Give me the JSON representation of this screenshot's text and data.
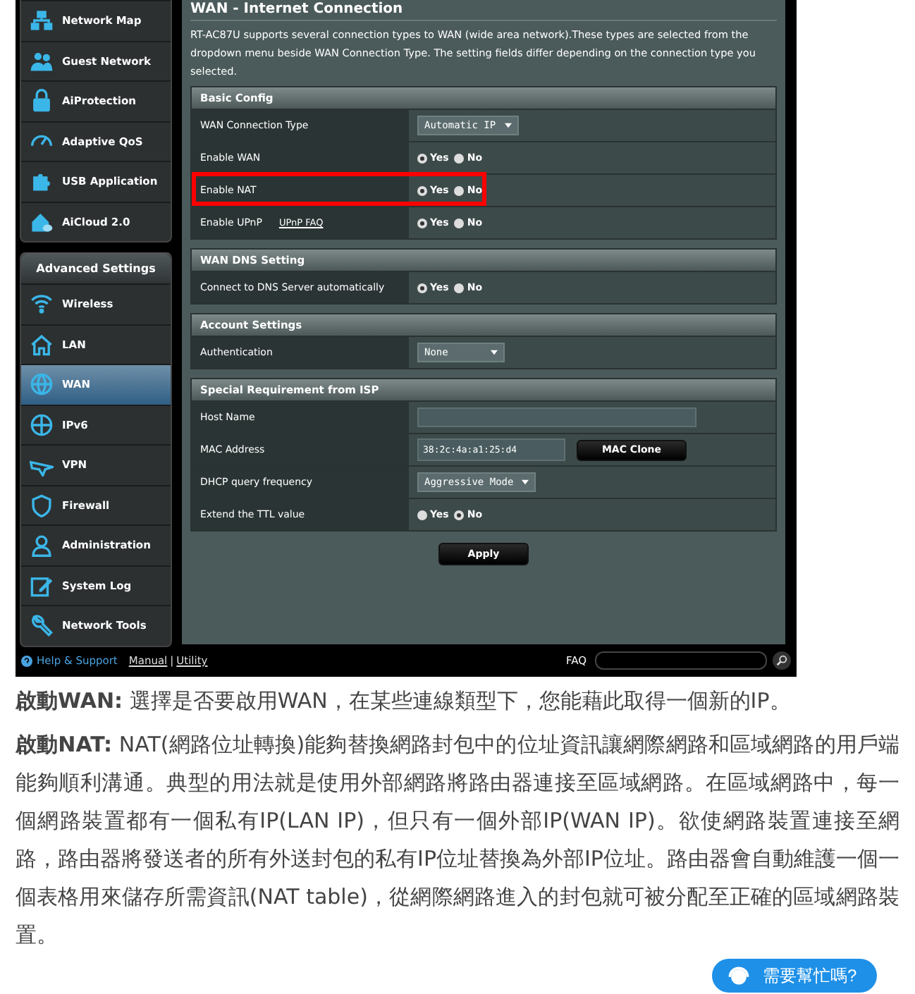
{
  "sidebar": {
    "items": [
      {
        "label": "Network Map",
        "selected": false
      },
      {
        "label": "Guest Network",
        "selected": false
      },
      {
        "label": "AiProtection",
        "selected": false
      },
      {
        "label": "Adaptive QoS",
        "selected": false
      },
      {
        "label": "USB Application",
        "selected": false
      },
      {
        "label": "AiCloud 2.0",
        "selected": false
      }
    ],
    "section_title": "Advanced Settings",
    "advanced_items": [
      {
        "label": "Wireless",
        "selected": false
      },
      {
        "label": "LAN",
        "selected": false
      },
      {
        "label": "WAN",
        "selected": true
      },
      {
        "label": "IPv6",
        "selected": false
      },
      {
        "label": "VPN",
        "selected": false
      },
      {
        "label": "Firewall",
        "selected": false
      },
      {
        "label": "Administration",
        "selected": false
      },
      {
        "label": "System Log",
        "selected": false
      },
      {
        "label": "Network Tools",
        "selected": false
      }
    ]
  },
  "page_title": "WAN - Internet Connection",
  "description": "RT-AC87U supports several connection types to WAN (wide area network).These types are selected from the dropdown menu beside WAN Connection Type. The setting fields differ depending on the connection type you selected.",
  "sections": [
    {
      "title": "Basic Config",
      "rows": [
        {
          "label": "WAN Connection Type",
          "kind": "select",
          "value": "Automatic IP",
          "highlighted": false
        },
        {
          "label": "Enable WAN",
          "kind": "radio",
          "options": [
            {
              "label": "Yes",
              "selected": true
            },
            {
              "label": "No",
              "selected": false
            }
          ],
          "highlighted": false
        },
        {
          "label": "Enable NAT",
          "kind": "radio",
          "options": [
            {
              "label": "Yes",
              "selected": true
            },
            {
              "label": "No",
              "selected": false
            }
          ],
          "highlighted": true
        },
        {
          "label": "Enable UPnP",
          "link": "UPnP  FAQ",
          "kind": "radio",
          "options": [
            {
              "label": "Yes",
              "selected": true
            },
            {
              "label": "No",
              "selected": false
            }
          ],
          "highlighted": false
        }
      ]
    },
    {
      "title": "WAN DNS Setting",
      "rows": [
        {
          "label": "Connect to DNS Server automatically",
          "kind": "radio",
          "options": [
            {
              "label": "Yes",
              "selected": true
            },
            {
              "label": "No",
              "selected": false
            }
          ],
          "highlighted": false
        }
      ]
    },
    {
      "title": "Account Settings",
      "rows": [
        {
          "label": "Authentication",
          "kind": "select",
          "value": "None",
          "highlighted": false
        }
      ]
    },
    {
      "title": "Special Requirement from ISP",
      "rows": [
        {
          "label": "Host Name",
          "kind": "text",
          "highlighted": false
        },
        {
          "label": "MAC Address",
          "kind": "mac",
          "value": "38:2c:4a:a1:25:d4",
          "button": "MAC Clone",
          "highlighted": false
        },
        {
          "label": "DHCP query frequency",
          "kind": "select",
          "value": "Aggressive Mode",
          "highlighted": false
        },
        {
          "label": "Extend the TTL value",
          "kind": "radio",
          "options": [
            {
              "label": "Yes",
              "selected": false
            },
            {
              "label": "No",
              "selected": true
            }
          ],
          "highlighted": false
        }
      ]
    }
  ],
  "apply_button": "Apply",
  "footer": {
    "help": "Help & Support",
    "manual": "Manual",
    "separator": "|",
    "utility": "Utility",
    "faq": "FAQ"
  },
  "paragraphs": [
    "**啟動WAN:** 選擇是否要啟用WAN，在某些連線類型下，您能藉此取得一個新的IP。",
    "**啟動NAT:** NAT(網路位址轉換)能夠替換網路封包中的位址資訊讓網際網路和區域網路的用戶端能夠順利溝通。典型的用法就是使用外部網路將路由器連接至區域網路。在區域網路中，每一個網路裝置都有一個私有IP(LAN IP)，但只有一個外部IP(WAN IP)。欲使網路裝置連接至網路，路由器將發送者的所有外送封包的私有IP位址替換為外部IP位址。路由器會自動維護一個一個表格用來儲存所需資訊(NAT table)，從網際網路進入的封包就可被分配至正確的區域網路裝置。"
  ],
  "chat_button": "需要幫忙嗎?"
}
